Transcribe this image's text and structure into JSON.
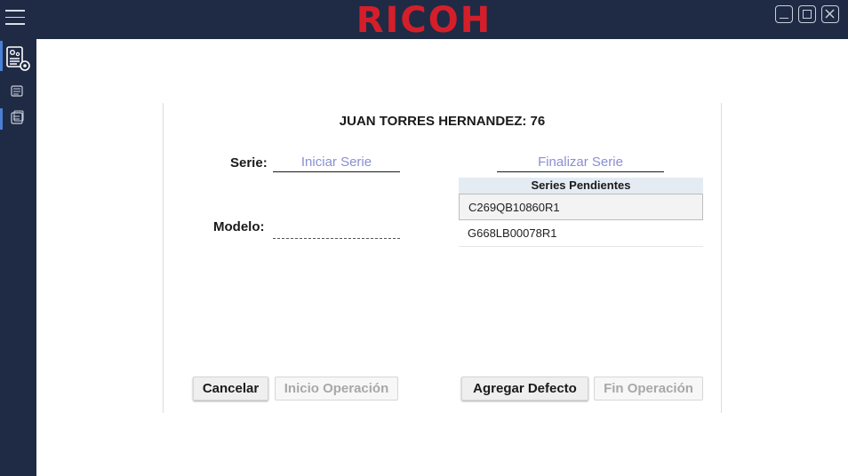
{
  "titlebar": {
    "logo_text": "RICOH",
    "logo_color": "#d41f2a",
    "background": "#1f2b45",
    "icons": [
      "hamburger-menu-icon",
      "minimize-icon",
      "maximize-icon",
      "close-icon"
    ]
  },
  "siderail": {
    "items": [
      {
        "icon": "config-document-gear-icon",
        "active": true
      },
      {
        "icon": "list-document-icon",
        "active": false
      },
      {
        "icon": "records-document-icon",
        "active": true
      }
    ]
  },
  "operator": {
    "title": "JUAN TORRES HERNANDEZ: 76"
  },
  "form": {
    "serie_label": "Serie:",
    "serie_placeholder": "Iniciar Serie",
    "finalizar_placeholder": "Finalizar Serie",
    "modelo_label": "Modelo:",
    "modelo_value": ""
  },
  "series_pending": {
    "header": "Series Pendientes",
    "items": [
      {
        "serial": "C269QB10860R1",
        "selected": true
      },
      {
        "serial": "G668LB00078R1",
        "selected": false
      }
    ]
  },
  "actions": {
    "cancel_label": "Cancelar",
    "inicio_label": "Inicio Operación",
    "agregar_label": "Agregar Defecto",
    "fin_label": "Fin Operación"
  }
}
